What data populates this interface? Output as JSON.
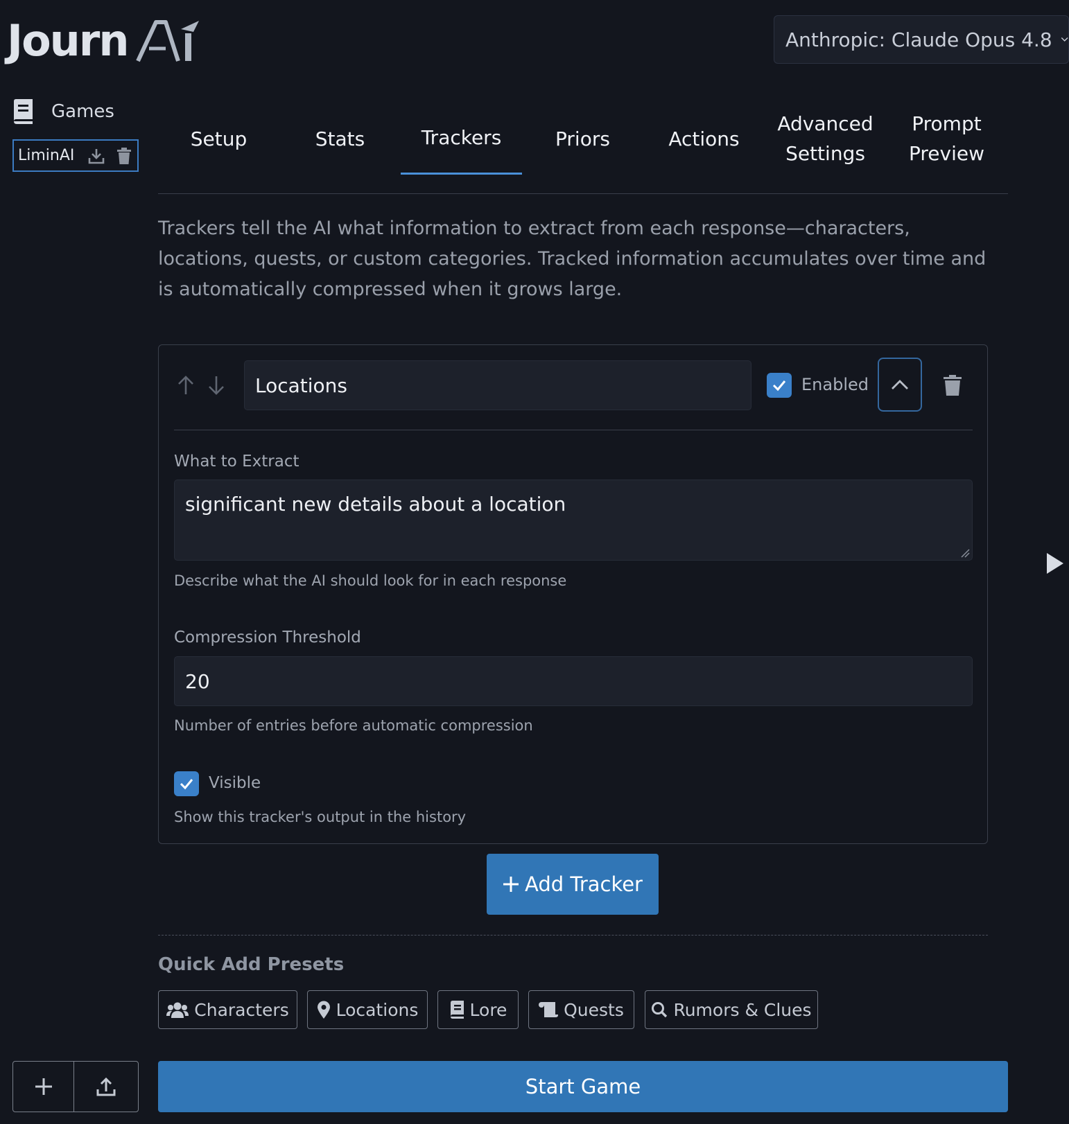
{
  "app": {
    "logo_text": "Journ",
    "logo_mark": "Ai",
    "model_select": "Anthropic: Claude Opus 4.8"
  },
  "sidebar": {
    "games_label": "Games",
    "selected_game": "LiminAI"
  },
  "tabs": [
    {
      "label": "Setup"
    },
    {
      "label": "Stats"
    },
    {
      "label": "Trackers",
      "active": true
    },
    {
      "label": "Priors"
    },
    {
      "label": "Actions"
    },
    {
      "label": "Advanced Settings"
    },
    {
      "label": "Prompt Preview"
    }
  ],
  "trackers_page": {
    "description": "Trackers tell the AI what information to extract from each response—characters, locations, quests, or custom categories. Tracked information accumulates over time and is automatically compressed when it grows large.",
    "tracker": {
      "name": "Locations",
      "enabled_label": "Enabled",
      "enabled": true,
      "extract_label": "What to Extract",
      "extract_value": "significant new details about a location",
      "extract_help": "Describe what the AI should look for in each response",
      "threshold_label": "Compression Threshold",
      "threshold_value": "20",
      "threshold_help": "Number of entries before automatic compression",
      "visible_label": "Visible",
      "visible": true,
      "visible_help": "Show this tracker's output in the history"
    },
    "add_tracker_label": "Add Tracker",
    "presets_title": "Quick Add Presets",
    "presets": [
      {
        "label": "Characters",
        "icon": "users-icon"
      },
      {
        "label": "Locations",
        "icon": "map-pin-icon"
      },
      {
        "label": "Lore",
        "icon": "book-icon"
      },
      {
        "label": "Quests",
        "icon": "scroll-icon"
      },
      {
        "label": "Rumors & Clues",
        "icon": "search-icon"
      }
    ],
    "start_game_label": "Start Game"
  },
  "colors": {
    "background": "#13161e",
    "accent": "#3176b6",
    "active_tab_underline": "#4a90d9"
  }
}
